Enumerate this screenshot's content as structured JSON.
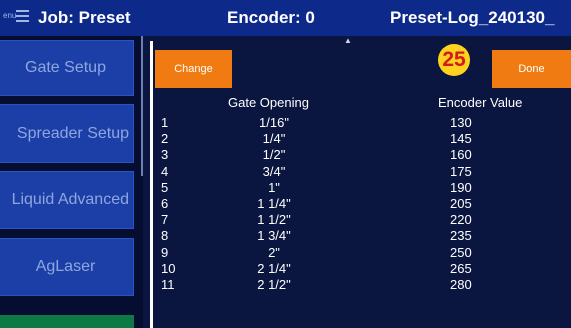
{
  "header": {
    "menu_word": "enu",
    "job": "Job: Preset",
    "encoder": "Encoder: 0",
    "log": "Preset-Log_240130_"
  },
  "sidebar": {
    "items": [
      {
        "label": "Gate Setup"
      },
      {
        "label": "Spreader Setup"
      },
      {
        "label": "Liquid Advanced"
      },
      {
        "label": "AgLaser"
      },
      {
        "label": ""
      }
    ]
  },
  "toolbar": {
    "change_label": "Change",
    "done_label": "Done",
    "badge": "25"
  },
  "table": {
    "headers": [
      "Gate Opening",
      "Encoder Value"
    ],
    "rows": [
      {
        "num": "1",
        "gate": "1/16\"",
        "enc": "130"
      },
      {
        "num": "2",
        "gate": "1/4\"",
        "enc": "145"
      },
      {
        "num": "3",
        "gate": "1/2\"",
        "enc": "160"
      },
      {
        "num": "4",
        "gate": "3/4\"",
        "enc": "175"
      },
      {
        "num": "5",
        "gate": "1\"",
        "enc": "190"
      },
      {
        "num": "6",
        "gate": "1 1/4\"",
        "enc": "205"
      },
      {
        "num": "7",
        "gate": "1 1/2\"",
        "enc": "220"
      },
      {
        "num": "8",
        "gate": "1 3/4\"",
        "enc": "235"
      },
      {
        "num": "9",
        "gate": "2\"",
        "enc": "250"
      },
      {
        "num": "10",
        "gate": "2 1/4\"",
        "enc": "265"
      },
      {
        "num": "11",
        "gate": "2 1/2\"",
        "enc": "280"
      }
    ]
  },
  "colors": {
    "topbar": "#0d2a8a",
    "nav_button": "#1b3fa6",
    "accent_orange": "#f07b12",
    "badge_yellow": "#ffd21f",
    "badge_text": "#d21b1b"
  }
}
